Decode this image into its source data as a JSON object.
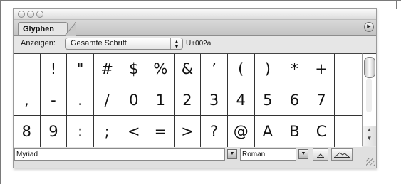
{
  "panel": {
    "tab_label": "Glyphen",
    "show_label": "Anzeigen:",
    "show_select_value": "Gesamte Schrift",
    "unicode_value": "U+002a",
    "glyphs": [
      "",
      "!",
      "\"",
      "#",
      "$",
      "%",
      "&",
      "’",
      "(",
      ")",
      "*",
      "+",
      "",
      ",",
      "-",
      ".",
      "/",
      "0",
      "1",
      "2",
      "3",
      "4",
      "5",
      "6",
      "7",
      "",
      "8",
      "9",
      ":",
      ";",
      "<",
      "=",
      ">",
      "?",
      "@",
      "A",
      "B",
      "C",
      ""
    ],
    "font_family_value": "Myriad",
    "font_style_value": "Roman"
  },
  "icons": {
    "menu": "flyout-menu-icon",
    "select_arrows": "updown-arrows-icon",
    "dropdown": "dropdown-arrow-icon",
    "zoom_out": "small-mountain-icon",
    "zoom_in": "large-mountain-icon",
    "resize": "resize-grip-icon"
  },
  "colors": {
    "panel_bg": "#e6e6e6",
    "grid_bg": "#ffffff",
    "grid_lines": "#333333"
  }
}
